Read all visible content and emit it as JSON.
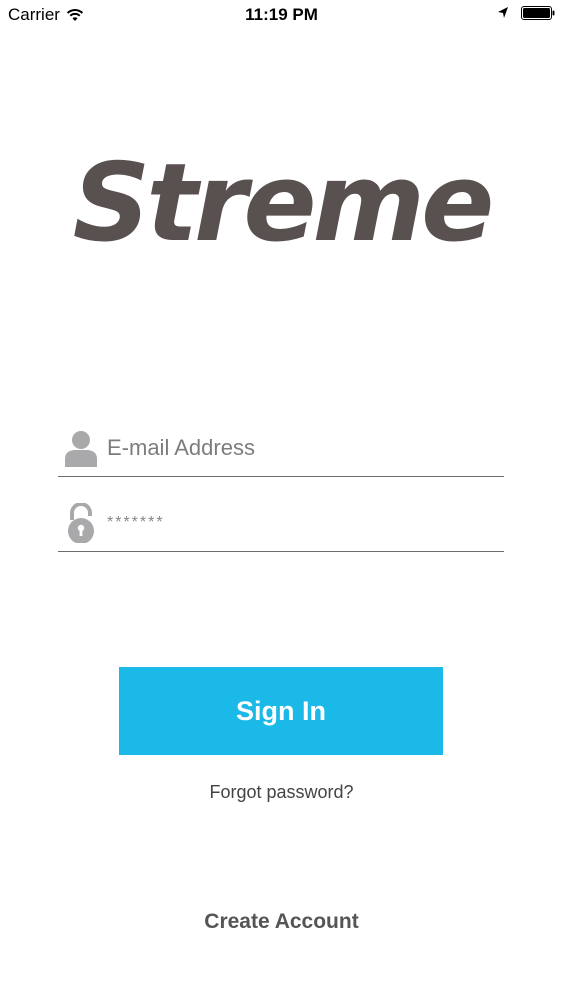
{
  "status_bar": {
    "carrier": "Carrier",
    "time": "11:19 PM"
  },
  "logo": {
    "text": "Streme",
    "color": "#58514f"
  },
  "login": {
    "email_placeholder": "E-mail Address",
    "password_value": "*******"
  },
  "actions": {
    "sign_in_label": "Sign In",
    "forgot_password_label": "Forgot password?",
    "create_account_label": "Create Account"
  },
  "colors": {
    "accent": "#1ab9e8",
    "icon_gray": "#a9a9ab"
  },
  "icons": {
    "email": "person-icon",
    "password": "lock-icon"
  }
}
